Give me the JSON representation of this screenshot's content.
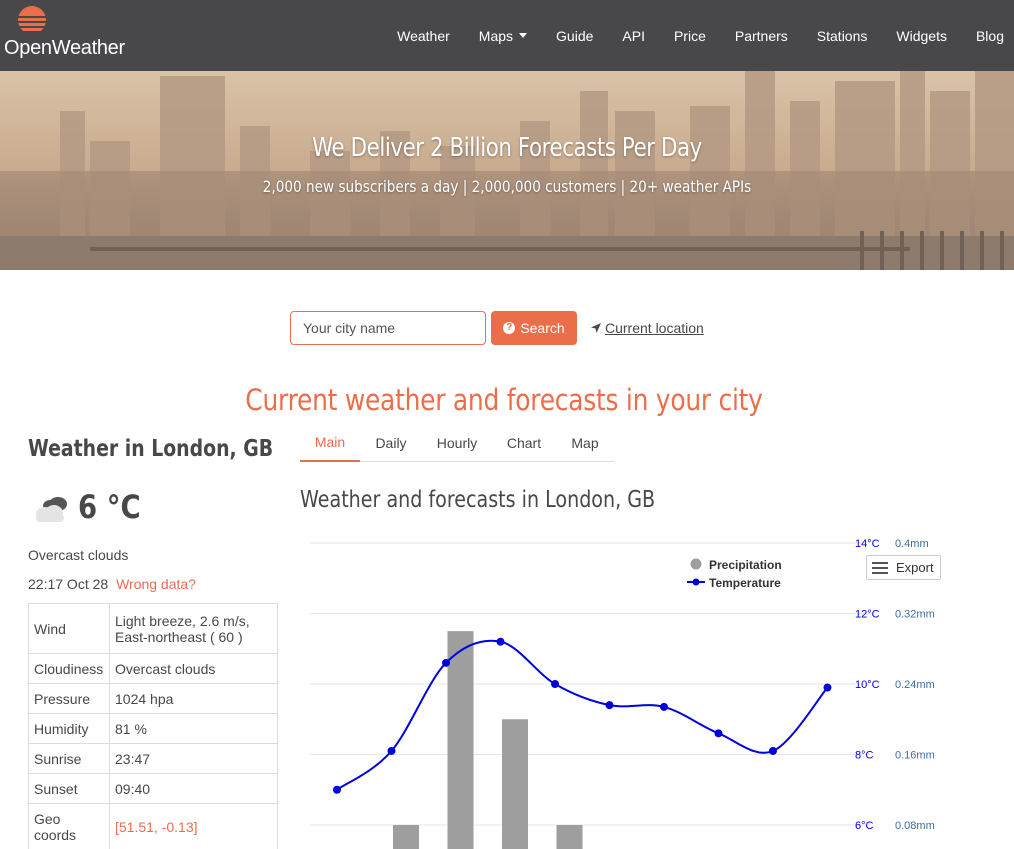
{
  "brand": {
    "name": "OpenWeather"
  },
  "nav": [
    {
      "label": "Weather"
    },
    {
      "label": "Maps",
      "dropdown": true
    },
    {
      "label": "Guide"
    },
    {
      "label": "API"
    },
    {
      "label": "Price"
    },
    {
      "label": "Partners"
    },
    {
      "label": "Stations"
    },
    {
      "label": "Widgets"
    },
    {
      "label": "Blog"
    }
  ],
  "hero": {
    "title": "We Deliver 2 Billion Forecasts Per Day",
    "subtitle": "2,000 new subscribers a day | 2,000,000 customers | 20+ weather APIs"
  },
  "search": {
    "placeholder": "Your city name",
    "button_label": "Search",
    "current_location": "Current location"
  },
  "headline": "Current weather and forecasts in your city",
  "city": {
    "title": "Weather in London, GB",
    "temperature": "6 °C",
    "description": "Overcast clouds",
    "time": "22:17 Oct 28",
    "wrong_data": "Wrong data?",
    "icon": "overcast-cloud-icon",
    "details": [
      {
        "key": "Wind",
        "value": "Light breeze, 2.6 m/s, East-northeast ( 60 )"
      },
      {
        "key": "Cloudiness",
        "value": "Overcast clouds"
      },
      {
        "key": "Pressure",
        "value": "1024 hpa"
      },
      {
        "key": "Humidity",
        "value": "81 %"
      },
      {
        "key": "Sunrise",
        "value": "23:47"
      },
      {
        "key": "Sunset",
        "value": "09:40"
      },
      {
        "key": "Geo coords",
        "value": "[51.51, -0.13]"
      }
    ]
  },
  "tabs": [
    {
      "label": "Main",
      "active": true
    },
    {
      "label": "Daily"
    },
    {
      "label": "Hourly"
    },
    {
      "label": "Chart"
    },
    {
      "label": "Map"
    }
  ],
  "forecast_title": "Weather and forecasts in London, GB",
  "export_label": "Export",
  "colors": {
    "accent": "#eb6e4b",
    "navbar": "#48484a",
    "temperature_line": "#0000dd",
    "precip_bar": "#9e9e9e"
  },
  "chart_data": {
    "type": "line",
    "legend": [
      "Precipitation",
      "Temperature"
    ],
    "legend_placement": "top-right",
    "grid": true,
    "temp_ticks": [
      "14°C",
      "12°C",
      "10°C",
      "8°C",
      "6°C"
    ],
    "precip_ticks": [
      "0.4mm",
      "0.32mm",
      "0.24mm",
      "0.16mm",
      "0.08mm"
    ],
    "temp_ylim": [
      6,
      14
    ],
    "precip_ylim": [
      0.08,
      0.4
    ],
    "series": [
      {
        "name": "Temperature",
        "values": [
          7.0,
          8.1,
          10.6,
          11.2,
          10.0,
          9.4,
          9.35,
          8.6,
          8.1,
          9.9
        ]
      },
      {
        "name": "Precipitation",
        "values": [
          0,
          0.08,
          0.3,
          0.2,
          0.08,
          0,
          0,
          0,
          0,
          0
        ]
      }
    ]
  }
}
